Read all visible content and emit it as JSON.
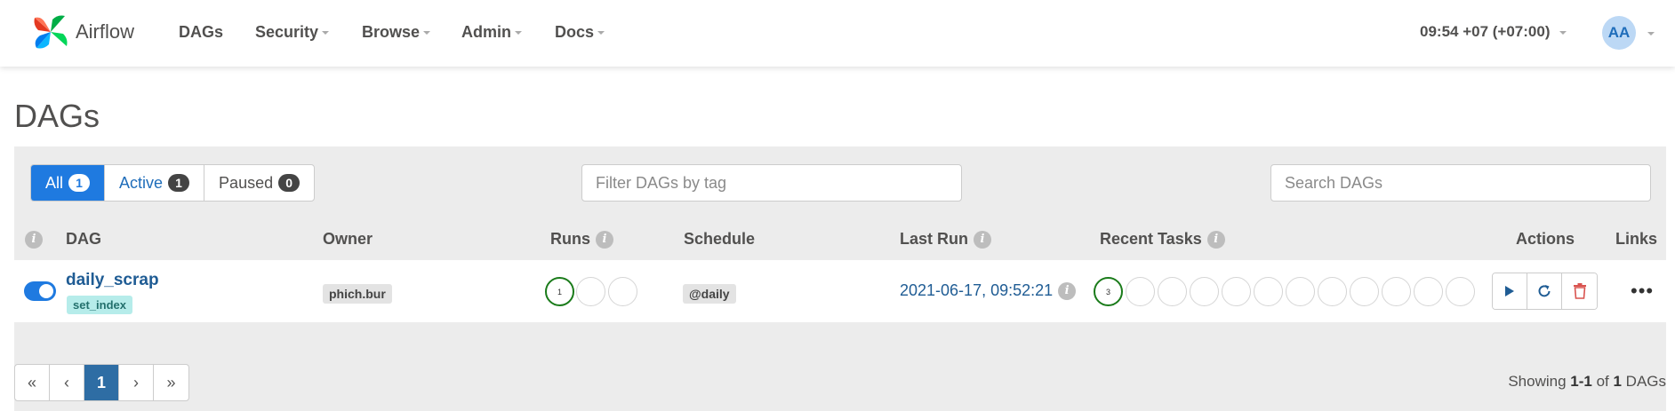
{
  "brand": {
    "name": "Airflow"
  },
  "nav": {
    "items": [
      {
        "label": "DAGs",
        "dropdown": false
      },
      {
        "label": "Security",
        "dropdown": true
      },
      {
        "label": "Browse",
        "dropdown": true
      },
      {
        "label": "Admin",
        "dropdown": true
      },
      {
        "label": "Docs",
        "dropdown": true
      }
    ],
    "clock": "09:54 +07 (+07:00)",
    "avatar": "AA"
  },
  "page_title": "DAGs",
  "filters": {
    "status": [
      {
        "label": "All",
        "count": "1"
      },
      {
        "label": "Active",
        "count": "1"
      },
      {
        "label": "Paused",
        "count": "0"
      }
    ],
    "tag_placeholder": "Filter DAGs by tag",
    "search_placeholder": "Search DAGs"
  },
  "table": {
    "headers": {
      "dag": "DAG",
      "owner": "Owner",
      "runs": "Runs",
      "schedule": "Schedule",
      "last_run": "Last Run",
      "recent_tasks": "Recent Tasks",
      "actions": "Actions",
      "links": "Links"
    },
    "rows": [
      {
        "dag_id": "daily_scrap",
        "tag": "set_index",
        "owner": "phich.bur",
        "runs": [
          "1",
          "",
          ""
        ],
        "schedule": "@daily",
        "last_run": "2021-06-17, 09:52:21",
        "recent_tasks": [
          "3",
          "",
          "",
          "",
          "",
          "",
          "",
          "",
          "",
          "",
          "",
          ""
        ]
      }
    ]
  },
  "pagination": {
    "first": "«",
    "prev": "‹",
    "current": "1",
    "next": "›",
    "last": "»",
    "showing_prefix": "Showing ",
    "showing_range": "1-1",
    "showing_of": " of ",
    "showing_total": "1",
    "showing_suffix": " DAGs"
  },
  "colors": {
    "primary": "#1f7ae0",
    "success": "#1a7b1a",
    "danger": "#d9534f"
  }
}
